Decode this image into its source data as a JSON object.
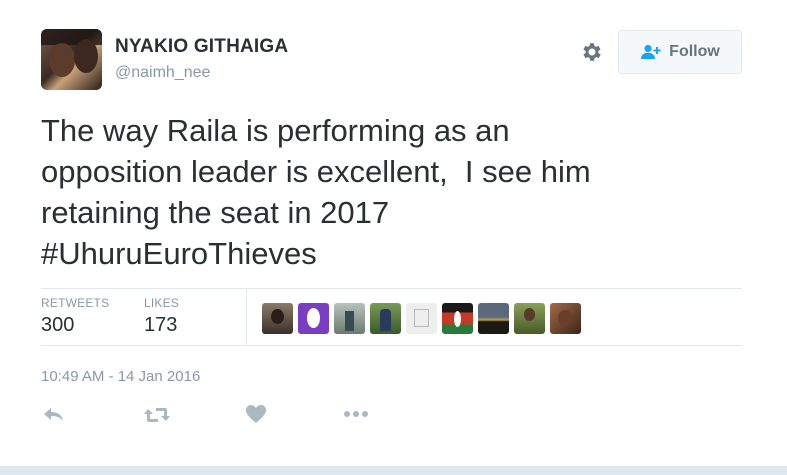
{
  "user": {
    "full_name": "NYAKIO GITHAIGA",
    "screen_name": "@naimh_nee"
  },
  "follow_button": {
    "label": "Follow",
    "icon": "add-person-icon"
  },
  "settings": {
    "icon": "gear-icon"
  },
  "tweet": {
    "line1": "The way Raila is performing as an",
    "line2": "opposition leader is excellent,  I see him",
    "line3": "retaining the seat in 2017",
    "line4": "#UhuruEuroThieves"
  },
  "stats": {
    "retweets_label": "RETWEETS",
    "retweets_value": "300",
    "likes_label": "LIKES",
    "likes_value": "173"
  },
  "liker_avatars": [
    {
      "name": "liker-1",
      "color": "#6b5a4b"
    },
    {
      "name": "liker-2",
      "color": "#7a3fc0"
    },
    {
      "name": "liker-3",
      "color": "#9aa6a0"
    },
    {
      "name": "liker-4",
      "color": "#4c6b3a"
    },
    {
      "name": "liker-5",
      "color": "#d6d6d6"
    },
    {
      "name": "liker-6",
      "color": "#c43a2a"
    },
    {
      "name": "liker-7",
      "color": "#2a2e22"
    },
    {
      "name": "liker-8",
      "color": "#5f6b3a"
    },
    {
      "name": "liker-9",
      "color": "#8a5a3e"
    }
  ],
  "timestamp": "10:49 AM - 14 Jan 2016",
  "actions": {
    "reply_icon": "reply-icon",
    "retweet_icon": "retweet-icon",
    "like_icon": "heart-icon",
    "more_icon": "more-icon"
  },
  "colors": {
    "text": "#292f33",
    "muted": "#8899a6",
    "icon": "#aab8c2",
    "border": "#e1e8ed"
  }
}
